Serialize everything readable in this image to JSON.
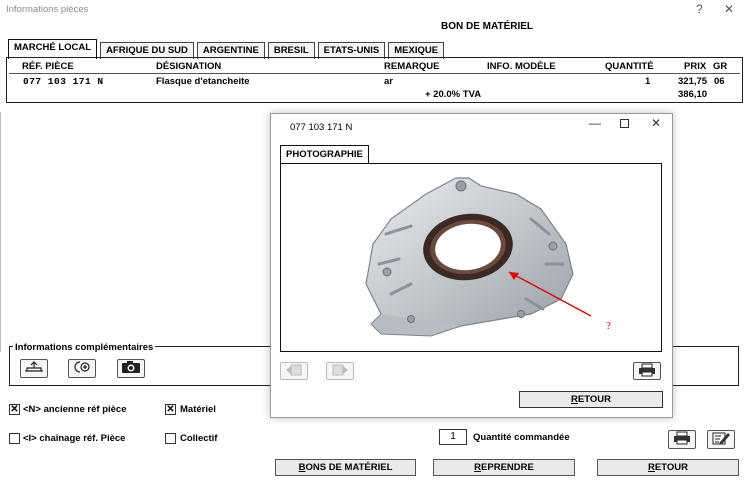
{
  "window": {
    "title": "Informations pièces",
    "help_glyph": "?",
    "close_glyph": "✕"
  },
  "document_title": "BON DE MATÉRIEL",
  "tabs": [
    {
      "label": "MARCHÉ LOCAL",
      "active": true
    },
    {
      "label": "AFRIQUE DU SUD",
      "active": false
    },
    {
      "label": "ARGENTINE",
      "active": false
    },
    {
      "label": "BRESIL",
      "active": false
    },
    {
      "label": "ETATS-UNIS",
      "active": false
    },
    {
      "label": "MEXIQUE",
      "active": false
    }
  ],
  "table": {
    "headers": {
      "ref": "RÉF. PIÈCE",
      "designation": "DÉSIGNATION",
      "remarque": "REMARQUE",
      "info": "INFO. MODÈLE",
      "quantite": "QUANTITÉ",
      "prix": "PRIX",
      "gr": "GR"
    },
    "row": {
      "ref": "077 103 171 N",
      "designation": "Flasque d'etancheite",
      "remarque": "ar",
      "quantite": "1",
      "prix": "321,75",
      "gr": "06"
    },
    "tva_label": "+ 20.0% TVA",
    "tva_total": "386,10"
  },
  "info_comp": {
    "label": "Informations complémentaires",
    "icons": [
      "scale-icon",
      "add-circle-icon",
      "camera-icon"
    ]
  },
  "options": {
    "ancienne_ref": {
      "label": "<N> ancienne réf pièce",
      "checked": true
    },
    "chainage_ref": {
      "label": "<I> chaînage réf. Pièce",
      "checked": false
    },
    "materiel": {
      "label": "Matériel",
      "checked": true
    },
    "collectif": {
      "label": "Collectif",
      "checked": false
    }
  },
  "quantity": {
    "value": "1",
    "label": "Quantité commandée"
  },
  "buttons": {
    "bons": "BONS DE MATÉRIEL",
    "reprendre": "REPRENDRE",
    "retour": "RETOUR"
  },
  "dialog": {
    "title": "077 103 171 N",
    "tab_label": "PHOTOGRAPHIE",
    "annotation": "?",
    "retour": "RETOUR",
    "accent_color": "#e00000"
  }
}
